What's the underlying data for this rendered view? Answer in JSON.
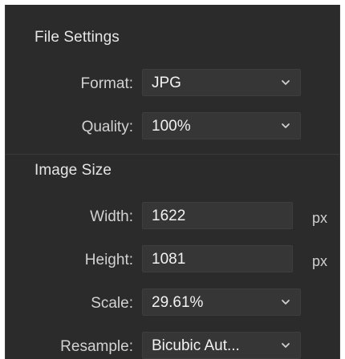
{
  "file_settings": {
    "title": "File Settings",
    "format": {
      "label": "Format:",
      "value": "JPG"
    },
    "quality": {
      "label": "Quality:",
      "value": "100%"
    }
  },
  "image_size": {
    "title": "Image Size",
    "width": {
      "label": "Width:",
      "value": "1622",
      "unit": "px"
    },
    "height": {
      "label": "Height:",
      "value": "1081",
      "unit": "px"
    },
    "scale": {
      "label": "Scale:",
      "value": "29.61%"
    },
    "resample": {
      "label": "Resample:",
      "value": "Bicubic Aut..."
    }
  },
  "icons": {
    "dropdown": "chevron-down-icon"
  },
  "colors": {
    "panel_background": "#2b2b2b",
    "field_background": "#363636",
    "text": "#e6e6e6"
  }
}
